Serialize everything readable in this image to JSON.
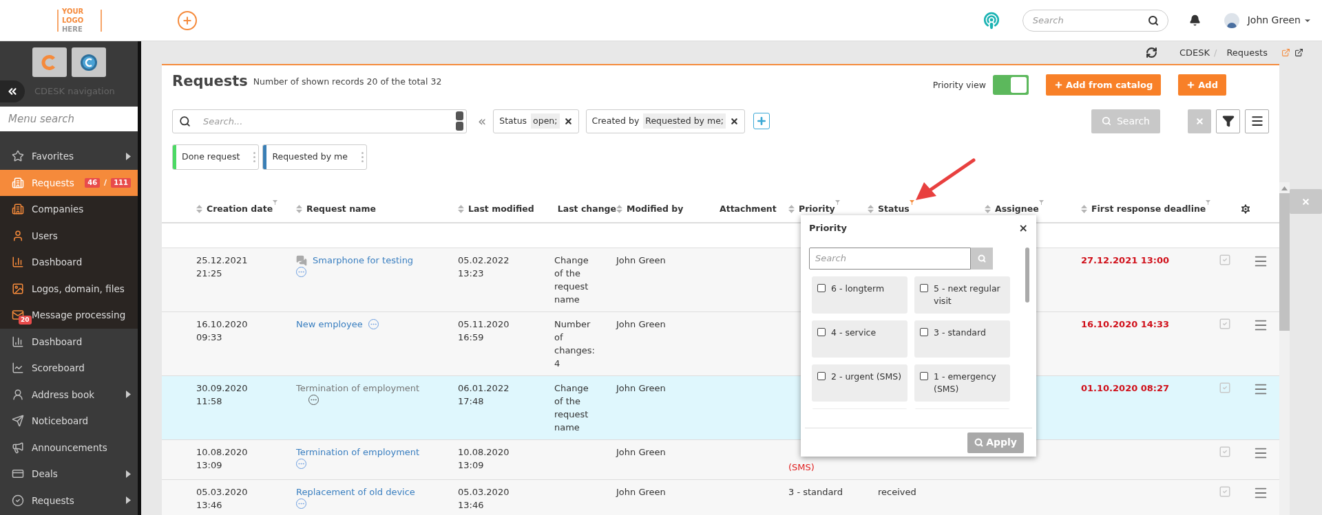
{
  "header": {
    "logo_lines": [
      "YOUR LOGO",
      "HERE"
    ],
    "search": {
      "placeholder": "Search"
    },
    "user": "John Green"
  },
  "sidebar": {
    "title": "CDESK navigation",
    "search": {
      "placeholder": "Menu search"
    },
    "items": [
      {
        "label": "Favorites",
        "kind": "system",
        "selected": false,
        "has_submenu": true
      },
      {
        "label": "Requests",
        "kind": "module",
        "selected": true,
        "has_submenu": false,
        "badges": [
          "46",
          "111"
        ],
        "badge_separator": "/"
      },
      {
        "label": "Companies",
        "kind": "module",
        "selected": false,
        "has_submenu": false
      },
      {
        "label": "Users",
        "kind": "module",
        "selected": false,
        "has_submenu": false
      },
      {
        "label": "Dashboard",
        "kind": "module",
        "selected": false,
        "has_submenu": false
      },
      {
        "label": "Logos, domain, files",
        "kind": "module",
        "selected": false,
        "has_submenu": false
      },
      {
        "label": "Message processing",
        "kind": "module",
        "selected": false,
        "has_submenu": false,
        "icon_badge": "20"
      },
      {
        "label": "Dashboard",
        "kind": "system",
        "selected": false,
        "has_submenu": false
      },
      {
        "label": "Scoreboard",
        "kind": "system",
        "selected": false,
        "has_submenu": false
      },
      {
        "label": "Address book",
        "kind": "system",
        "selected": false,
        "has_submenu": true
      },
      {
        "label": "Noticeboard",
        "kind": "system",
        "selected": false,
        "has_submenu": false
      },
      {
        "label": "Announcements",
        "kind": "system",
        "selected": false,
        "has_submenu": false
      },
      {
        "label": "Deals",
        "kind": "system",
        "selected": false,
        "has_submenu": true
      },
      {
        "label": "Requests",
        "kind": "system",
        "selected": false,
        "has_submenu": true
      }
    ]
  },
  "breadcrumb": [
    "CDESK",
    "Requests"
  ],
  "breadcrumb_separator": "/",
  "page": {
    "title": "Requests",
    "subtitle": "Number of shown records 20 of the total 32",
    "priority_view": {
      "label": "Priority view",
      "on": true
    },
    "buttons": [
      "Add from catalog",
      "Add"
    ],
    "search": {
      "placeholder": "Search..."
    },
    "collapse": "«",
    "filters": [
      {
        "label": "Status",
        "value": "open;"
      },
      {
        "label": "Created by",
        "value": "Requested by me;"
      }
    ],
    "search_button": {
      "label": "Search",
      "disabled": true
    },
    "saved_filters": [
      {
        "label": "Done request",
        "color": "#4cd964"
      },
      {
        "label": "Requested by me",
        "color": "#3a7fb5"
      }
    ]
  },
  "table": {
    "columns": [
      {
        "label": "Creation date",
        "sortable": true,
        "filterable": true,
        "filter_active": false
      },
      {
        "label": "Request name",
        "sortable": true,
        "filterable": false
      },
      {
        "label": "Last modified",
        "sortable": true,
        "filterable": false
      },
      {
        "label": "Last change",
        "sortable": false,
        "filterable": false
      },
      {
        "label": "Modified by",
        "sortable": true,
        "filterable": false
      },
      {
        "label": "Attachment",
        "sortable": false,
        "filterable": false
      },
      {
        "label": "Priority",
        "sortable": true,
        "filterable": true,
        "filter_active": false
      },
      {
        "label": "Status",
        "sortable": true,
        "filterable": true,
        "filter_active": true
      },
      {
        "label": "Assignee",
        "sortable": true,
        "filterable": true,
        "filter_active": false
      },
      {
        "label": "First response deadline",
        "sortable": true,
        "filterable": true,
        "filter_active": false
      }
    ],
    "rows": [
      {
        "created": "25.12.2021 21:25",
        "name": "Smarphone for testing",
        "has_comments": true,
        "modified": "05.02.2022 13:23",
        "change": "Change of the request name",
        "modified_by": "John Green",
        "deadline": "27.12.2021 13:00",
        "selected": false
      },
      {
        "created": "16.10.2020 09:33",
        "name": "New employee",
        "has_comments": false,
        "modified": "05.11.2020 16:59",
        "change": "Number of changes: 4",
        "modified_by": "John Green",
        "deadline": "16.10.2020 14:33",
        "selected": false
      },
      {
        "created": "30.09.2020 11:58",
        "name": "Termination of employment",
        "has_comments": false,
        "modified": "06.01.2022 17:48",
        "change": "Change of the request name",
        "modified_by": "John Green",
        "deadline": "01.10.2020 08:27",
        "selected": true
      },
      {
        "created": "10.08.2020 13:09",
        "name": "Termination of employment",
        "has_comments": false,
        "modified": "10.08.2020 13:09",
        "modified_by": "John Green",
        "priority": "(SMS)",
        "priority_urgent": true,
        "selected": false
      },
      {
        "created": "05.03.2020 13:46",
        "name": "Replacement of old device",
        "has_comments": false,
        "modified": "05.03.2020 13:46",
        "modified_by": "John Green",
        "priority": "3 - standard",
        "priority_urgent": false,
        "status": "received",
        "selected": false
      }
    ]
  },
  "popup": {
    "title": "Priority",
    "close": "×",
    "search": {
      "placeholder": "Search"
    },
    "apply": {
      "label": "Apply",
      "disabled": true
    },
    "options": [
      {
        "label": "6 - longterm",
        "checked": false
      },
      {
        "label": "5 - next regular visit",
        "checked": false
      },
      {
        "label": "4 - service",
        "checked": false
      },
      {
        "label": "3 - standard",
        "checked": false
      },
      {
        "label": "2 - urgent (SMS)",
        "checked": false
      },
      {
        "label": "1 - emergency (SMS)",
        "checked": false
      }
    ]
  }
}
